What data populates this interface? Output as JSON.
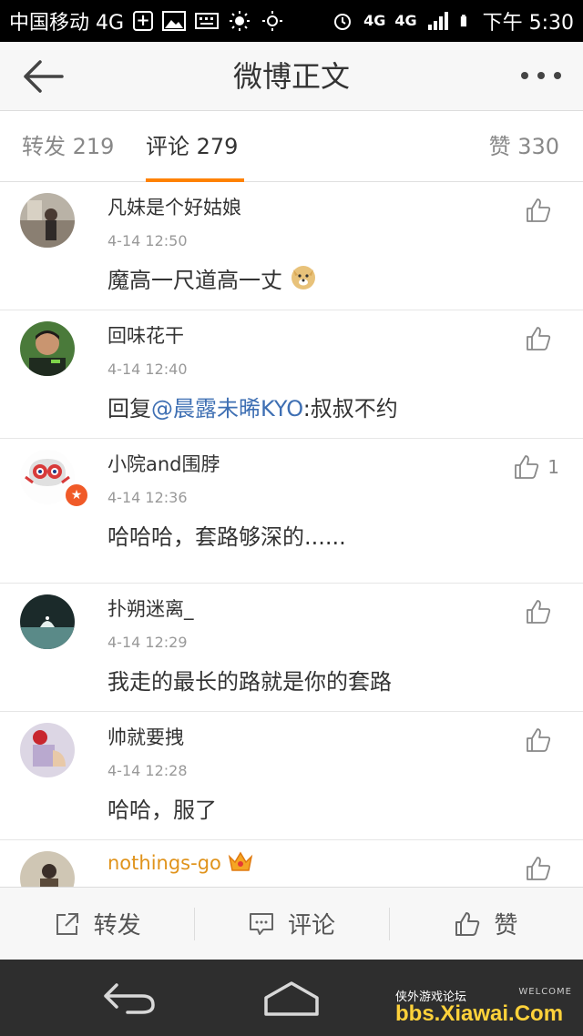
{
  "status_bar": {
    "carrier": "中国移动 4G",
    "network_left": "4G",
    "network_right": "4G",
    "time": "下午 5:30"
  },
  "header": {
    "title": "微博正文"
  },
  "tabs": [
    {
      "label": "转发 219"
    },
    {
      "label": "评论 279"
    },
    {
      "label": "赞 330"
    }
  ],
  "comments": [
    {
      "user": "凡妹是个好姑娘",
      "time": "4-14 12:50",
      "text": "魔高一尺道高一丈",
      "likes": ""
    },
    {
      "user": "回味花干",
      "time": "4-14 12:40",
      "text_prefix": "回复",
      "mention": "@晨露未晞KYO",
      "text_suffix": ":叔叔不约",
      "likes": ""
    },
    {
      "user": "小院and围脖",
      "time": "4-14 12:36",
      "text": "哈哈哈，套路够深的......",
      "likes": "1"
    },
    {
      "user": "扑朔迷离_",
      "time": "4-14 12:29",
      "text": "我走的最长的路就是你的套路",
      "likes": ""
    },
    {
      "user": "帅就要拽",
      "time": "4-14 12:28",
      "text": "哈哈，服了",
      "likes": ""
    },
    {
      "user": "nothings-go",
      "time": "",
      "text": "",
      "likes": ""
    }
  ],
  "actions": {
    "repost": "转发",
    "comment": "评论",
    "like": "赞"
  },
  "watermark": {
    "top": "侠外游戏论坛",
    "main": "bbs.Xiawai.Com",
    "welcome": "WELCOME"
  },
  "colors": {
    "accent": "#ff8200",
    "mention": "#3e6fb3",
    "vip_name": "#e0931b"
  }
}
